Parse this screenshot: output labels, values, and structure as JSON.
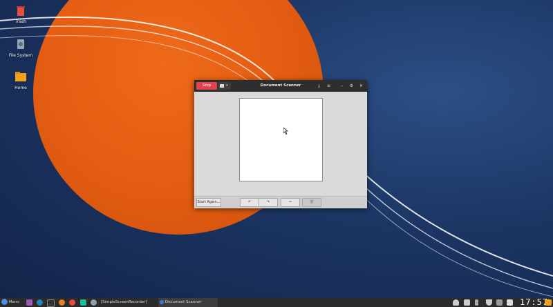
{
  "desktop": {
    "icons": [
      {
        "label": "Trash",
        "icon": "trash-icon"
      },
      {
        "label": "File System",
        "icon": "drive-icon"
      },
      {
        "label": "Home",
        "icon": "home-folder-icon"
      }
    ]
  },
  "window": {
    "title": "Document Scanner",
    "stop_label": "Stop",
    "scan_type_icon": "document-type-icon",
    "header_icons": [
      "save-icon",
      "menu-icon",
      "minimize-icon",
      "maximize-icon",
      "close-icon"
    ],
    "header_glyphs": [
      "⤓",
      "≡",
      "–",
      "⚙",
      "✕"
    ],
    "footer": {
      "start_again_label": "Start Again...",
      "rotate_left_glyph": "↶",
      "rotate_right_glyph": "↷",
      "crop_glyph": "✂",
      "delete_glyph": "🗑"
    }
  },
  "taskbar": {
    "menu_label": "Menu",
    "tasks": [
      {
        "label": "[SimpleScreenRecorder]"
      },
      {
        "label": "Document Scanner"
      }
    ],
    "clock": "17:57",
    "colors": {
      "active_task": "#3c3c3c",
      "accent_folder": "#f0a21e"
    }
  }
}
